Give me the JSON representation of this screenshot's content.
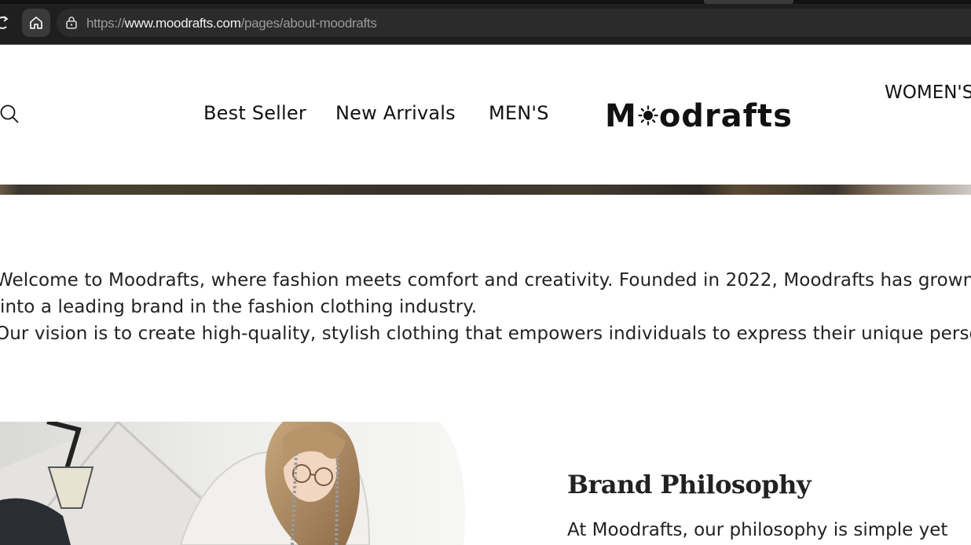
{
  "browser": {
    "url_prefix": "https://",
    "url_host": "www.moodrafts.com",
    "url_path": "/pages/about-moodrafts"
  },
  "header": {
    "nav": {
      "best_seller": "Best Seller",
      "new_arrivals": "New Arrivals",
      "mens": "MEN'S",
      "womens": "WOMEN'S"
    },
    "logo_text_a": "M",
    "logo_text_b": "odrafts"
  },
  "intro": {
    "line1": "Welcome to Moodrafts, where fashion meets comfort and creativity. Founded in 2022, Moodrafts has grown",
    "line2": "into a leading brand in the fashion clothing industry.",
    "line3": "Our vision is to create high-quality, stylish clothing that empowers individuals to express their unique personality"
  },
  "philosophy": {
    "title": "Brand Philosophy",
    "text": "At Moodrafts, our philosophy is simple yet"
  },
  "colors": {
    "chrome_bg": "#1f1f1f",
    "text": "#222222"
  },
  "icons": [
    "reload-icon",
    "home-icon",
    "lock-icon",
    "search-icon",
    "sun-logo-icon"
  ]
}
